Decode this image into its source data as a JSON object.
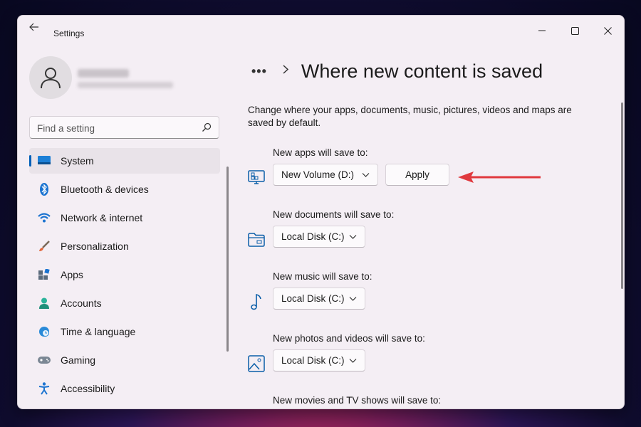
{
  "window": {
    "title": "Settings"
  },
  "sidebar": {
    "search_placeholder": "Find a setting",
    "items": [
      {
        "label": "System",
        "icon": "monitor-icon",
        "active": true
      },
      {
        "label": "Bluetooth & devices",
        "icon": "bluetooth-icon"
      },
      {
        "label": "Network & internet",
        "icon": "wifi-icon"
      },
      {
        "label": "Personalization",
        "icon": "brush-icon"
      },
      {
        "label": "Apps",
        "icon": "apps-icon"
      },
      {
        "label": "Accounts",
        "icon": "person-icon"
      },
      {
        "label": "Time & language",
        "icon": "globe-clock-icon"
      },
      {
        "label": "Gaming",
        "icon": "gamepad-icon"
      },
      {
        "label": "Accessibility",
        "icon": "accessibility-icon"
      }
    ]
  },
  "main": {
    "breadcrumb_more": "•••",
    "title": "Where new content is saved",
    "description": "Change where your apps, documents, music, pictures, videos and maps are saved by default.",
    "settings": [
      {
        "label": "New apps will save to:",
        "value": "New Volume (D:)",
        "icon": "apps-drive-icon",
        "button": "Apply"
      },
      {
        "label": "New documents will save to:",
        "value": "Local Disk (C:)",
        "icon": "folder-icon"
      },
      {
        "label": "New music will save to:",
        "value": "Local Disk (C:)",
        "icon": "music-note-icon"
      },
      {
        "label": "New photos and videos will save to:",
        "value": "Local Disk (C:)",
        "icon": "image-icon"
      },
      {
        "label": "New movies and TV shows will save to:"
      }
    ]
  },
  "colors": {
    "accent": "#005fb8",
    "annotation_arrow": "#e0393e"
  }
}
